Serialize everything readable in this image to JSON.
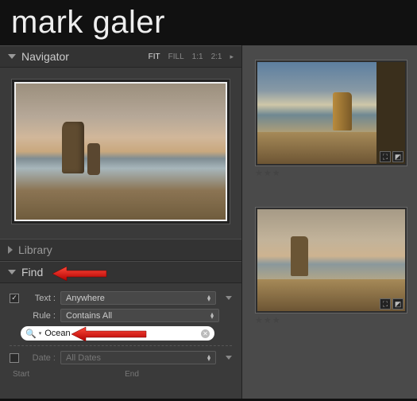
{
  "brand": {
    "first": "mark",
    "last": "galer"
  },
  "navigator": {
    "title": "Navigator",
    "ratios": [
      "FIT",
      "FILL",
      "1:1",
      "2:1"
    ],
    "active_ratio": "FIT"
  },
  "library": {
    "title": "Library"
  },
  "find": {
    "title": "Find",
    "text_enabled": true,
    "text_label": "Text :",
    "text_scope": "Anywhere",
    "rule_label": "Rule :",
    "rule_value": "Contains All",
    "search_value": "Ocean",
    "date_enabled": false,
    "date_label": "Date :",
    "date_value": "All Dates",
    "start_label": "Start",
    "end_label": "End"
  },
  "thumbnails": [
    {
      "rating": "★★★"
    },
    {
      "rating": "★★★"
    }
  ],
  "icons": {
    "checkmark": "✓",
    "magnifier": "🔍",
    "clear": "✕",
    "crop": "⛶",
    "adjust": "◩"
  }
}
